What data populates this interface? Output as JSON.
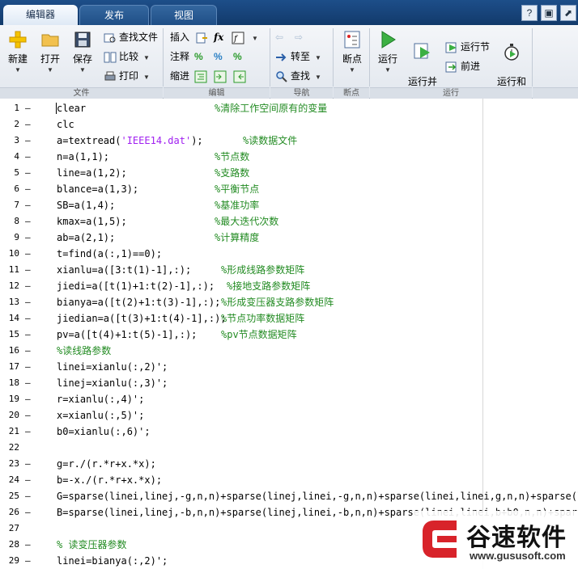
{
  "tabs": [
    {
      "label": "编辑器",
      "active": true
    },
    {
      "label": "发布",
      "active": false
    },
    {
      "label": "视图",
      "active": false
    }
  ],
  "quick_access": [
    "help-icon",
    "save-icon",
    "undock-icon"
  ],
  "ribbon": {
    "file": {
      "section_label": "文件",
      "new_label": "新建",
      "open_label": "打开",
      "save_label": "保存",
      "find_files_label": "查找文件",
      "compare_label": "比较",
      "print_label": "打印"
    },
    "edit": {
      "section_label": "编辑",
      "insert_label": "插入",
      "comment_label": "注释",
      "indent_label": "缩进",
      "fx_label": "fx"
    },
    "navigate": {
      "section_label": "导航",
      "goto_label": "转至",
      "find_label": "查找"
    },
    "breakpoints": {
      "section_label": "断点",
      "breakpoints_label": "断点"
    },
    "run": {
      "section_label": "运行",
      "run_label": "运行",
      "run_advance_label": "运行并\n前进",
      "run_section_label": "运行节",
      "advance_label": "前进",
      "run_time_label": "运行和\n计时"
    }
  },
  "code_lines": [
    {
      "n": "1",
      "code": "clear",
      "comment": "%清除工作空间原有的变量",
      "ccol": 265
    },
    {
      "n": "2",
      "code": "clc",
      "comment": "",
      "ccol": 0
    },
    {
      "n": "3",
      "code_pre": "a=textread(",
      "code_str": "'IEEE14.dat'",
      "code_post": ");",
      "comment": "%读数据文件",
      "ccol": 300
    },
    {
      "n": "4",
      "code": "n=a(1,1);",
      "comment": "%节点数",
      "ccol": 265
    },
    {
      "n": "5",
      "code": "line=a(1,2);",
      "comment": "%支路数",
      "ccol": 265
    },
    {
      "n": "6",
      "code": "blance=a(1,3);",
      "comment": "%平衡节点",
      "ccol": 265
    },
    {
      "n": "7",
      "code": "SB=a(1,4);",
      "comment": "%基准功率",
      "ccol": 265
    },
    {
      "n": "8",
      "code": "kmax=a(1,5);",
      "comment": "%最大迭代次数",
      "ccol": 265
    },
    {
      "n": "9",
      "code": "ab=a(2,1);",
      "comment": "%计算精度",
      "ccol": 265
    },
    {
      "n": "10",
      "code": "t=find(a(:,1)==0);",
      "comment": "",
      "ccol": 0
    },
    {
      "n": "11",
      "code": "xianlu=a([3:t(1)-1],:);",
      "comment": "%形成线路参数矩阵",
      "ccol": 273
    },
    {
      "n": "12",
      "code": "jiedi=a([t(1)+1:t(2)-1],:);",
      "comment": "%接地支路参数矩阵",
      "ccol": 280
    },
    {
      "n": "13",
      "code": "bianya=a([t(2)+1:t(3)-1],:);",
      "comment": "%形成变压器支路参数矩阵",
      "ccol": 273
    },
    {
      "n": "14",
      "code": "jiedian=a([t(3)+1:t(4)-1],:);",
      "comment": "%节点功率数据矩阵",
      "ccol": 273
    },
    {
      "n": "15",
      "code": "pv=a([t(4)+1:t(5)-1],:);",
      "comment": "%pv节点数据矩阵",
      "ccol": 273
    },
    {
      "n": "16",
      "code": "",
      "comment": "%读线路参数",
      "ccol": 70
    },
    {
      "n": "17",
      "code": "linei=xianlu(:,2)';",
      "comment": "",
      "ccol": 0
    },
    {
      "n": "18",
      "code": "linej=xianlu(:,3)';",
      "comment": "",
      "ccol": 0
    },
    {
      "n": "19",
      "code": "r=xianlu(:,4)';",
      "comment": "",
      "ccol": 0
    },
    {
      "n": "20",
      "code": "x=xianlu(:,5)';",
      "comment": "",
      "ccol": 0
    },
    {
      "n": "21",
      "code": "b0=xianlu(:,6)';",
      "comment": "",
      "ccol": 0
    },
    {
      "n": "22",
      "code": "",
      "comment": "",
      "ccol": 0
    },
    {
      "n": "23",
      "code": "g=r./(r.*r+x.*x);",
      "comment": "",
      "ccol": 0
    },
    {
      "n": "24",
      "code": "b=-x./(r.*r+x.*x);",
      "comment": "",
      "ccol": 0
    },
    {
      "n": "25",
      "code": "G=sparse(linei,linej,-g,n,n)+sparse(linej,linei,-g,n,n)+sparse(linei,linei,g,n,n)+sparse(lin",
      "comment": "",
      "ccol": 0
    },
    {
      "n": "26",
      "code": "B=sparse(linei,linej,-b,n,n)+sparse(linej,linei,-b,n,n)+sparse(linei,linei,b+b0,n,n)+sparse(",
      "comment": "",
      "ccol": 0
    },
    {
      "n": "27",
      "code": "",
      "comment": "",
      "ccol": 0
    },
    {
      "n": "28",
      "code": "",
      "comment": "% 读变压器参数",
      "ccol": 70
    },
    {
      "n": "29",
      "code": "linei=bianya(:,2)';",
      "comment": "",
      "ccol": 0
    }
  ],
  "watermark": {
    "title": "谷速软件",
    "url": "www.gususoft.com"
  },
  "colors": {
    "tab_bar": "#1d4e89",
    "comment": "#228b22",
    "string": "#a020f0",
    "ribbon_bg": "#eef1f5"
  }
}
